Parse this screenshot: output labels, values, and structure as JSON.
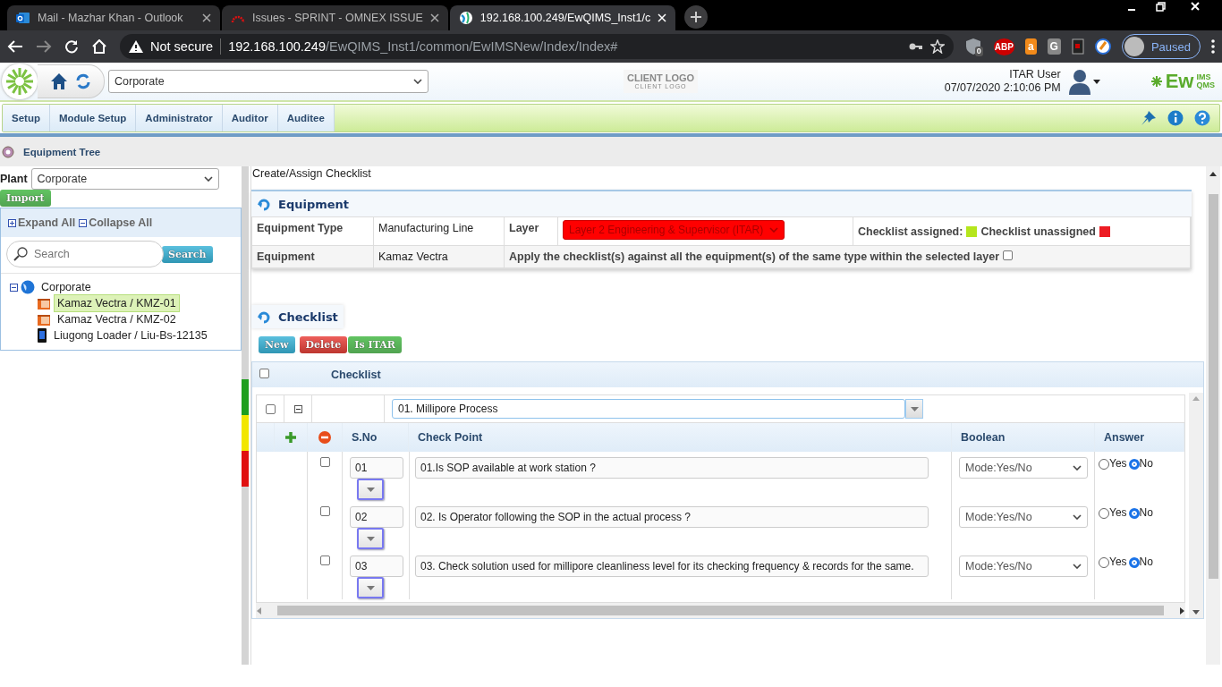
{
  "browser": {
    "tabs": [
      {
        "title": "Mail - Mazhar Khan - Outlook",
        "kind": "mail",
        "selected": false
      },
      {
        "title": "Issues - SPRINT - OMNEX ISSUE",
        "kind": "issues",
        "selected": false
      },
      {
        "title": "192.168.100.249/EwQIMS_Inst1/c",
        "kind": "app",
        "selected": true
      }
    ],
    "security": "Not secure",
    "url_host": "192.168.100.249",
    "url_path": "/EwQIMS_Inst1/common/EwIMSNew/Index/Index#",
    "extension_badge": "0",
    "extension_labels": [
      "ABP",
      "a",
      "G"
    ],
    "profile": "Paused"
  },
  "header": {
    "plant": "Corporate",
    "client_logo": "CLIENT LOGO",
    "client_logo_sub": "CLIENT LOGO",
    "user": "ITAR User",
    "datetime": "07/07/2020 2:10:06 PM",
    "brand": "Ew",
    "brand_top": "IMS",
    "brand_bottom": "QMS"
  },
  "menu": [
    "Setup",
    "Module Setup",
    "Administrator",
    "Auditor",
    "Auditee"
  ],
  "breadcrumb": "Equipment Tree",
  "sidebar": {
    "plant_label": "Plant",
    "plant": "Corporate",
    "import": "Import",
    "expand_all": "Expand All",
    "collapse_all": "Collapse All",
    "search_placeholder": "Search",
    "search_button": "Search",
    "tree": [
      {
        "label": "Corporate",
        "kind": "site",
        "expanded": true,
        "selected": false,
        "children": [
          {
            "label": "Kamaz Vectra / KMZ-01",
            "kind": "machine",
            "selected": true
          },
          {
            "label": "Kamaz Vectra / KMZ-02",
            "kind": "machine",
            "selected": false
          },
          {
            "label": "Liugong Loader / Liu-Bs-12135",
            "kind": "device",
            "selected": false
          }
        ]
      }
    ]
  },
  "layer_strip": [
    {
      "color": "#1f9e1f"
    },
    {
      "color": "#f2e600"
    },
    {
      "color": "#e01010"
    }
  ],
  "page_title": "Create/Assign Checklist",
  "equipment": {
    "title": "Equipment",
    "type_label": "Equipment Type",
    "type": "Manufacturing Line",
    "layer_label": "Layer",
    "layer": "Layer 2 Engineering & Supervisor (ITAR)",
    "legend": [
      {
        "label": "Checklist assigned:",
        "color": "#b5e61d"
      },
      {
        "label": "Checklist unassigned",
        "color": "#ed1c24"
      }
    ],
    "equipment_label": "Equipment",
    "equipment": "Kamaz Vectra",
    "apply_text": "Apply the checklist(s) against all the equipment(s) of the same type within the selected layer",
    "apply_checked": false
  },
  "checklist": {
    "title": "Checklist",
    "buttons": [
      {
        "label": "New",
        "kind": "info"
      },
      {
        "label": "Delete",
        "kind": "danger"
      },
      {
        "label": "Is ITAR",
        "kind": "success"
      }
    ],
    "header": "Checklist",
    "all_checked": false,
    "group": {
      "name": "01. Millipore Process",
      "checked": false,
      "expanded": true
    },
    "columns": [
      "S.No",
      "Check Point",
      "Boolean",
      "Answer"
    ],
    "rows": [
      {
        "checked": false,
        "sno": "01",
        "check_point": "01.Is SOP available at work station ?",
        "boolean": "Mode:Yes/No",
        "answers": [
          {
            "label": "Yes",
            "selected": false
          },
          {
            "label": "No",
            "selected": true
          }
        ]
      },
      {
        "checked": false,
        "sno": "02",
        "check_point": "02. Is Operator following the SOP in the actual process ?",
        "boolean": "Mode:Yes/No",
        "answers": [
          {
            "label": "Yes",
            "selected": false
          },
          {
            "label": "No",
            "selected": true
          }
        ]
      },
      {
        "checked": false,
        "sno": "03",
        "check_point": "03. Check solution used for millipore cleanliness level for its checking frequency & records for the same.",
        "boolean": "Mode:Yes/No",
        "answers": [
          {
            "label": "Yes",
            "selected": false
          },
          {
            "label": "No",
            "selected": true
          }
        ]
      }
    ]
  }
}
